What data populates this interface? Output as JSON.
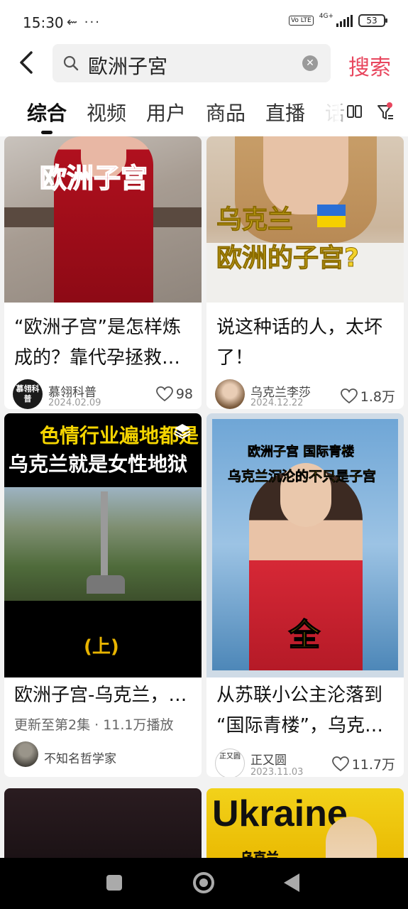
{
  "status_bar": {
    "time": "15:30",
    "left_icons": "⇜ ···",
    "volte": "Vo LTE",
    "network": "4G+",
    "battery": "53"
  },
  "search": {
    "query": "歐洲子宮",
    "button_label": "搜索",
    "clear_icon": "clear-icon",
    "search_icon": "search-icon"
  },
  "tabs": [
    {
      "label": "综合",
      "active": true
    },
    {
      "label": "视频",
      "active": false
    },
    {
      "label": "用户",
      "active": false
    },
    {
      "label": "商品",
      "active": false
    },
    {
      "label": "直播",
      "active": false
    },
    {
      "label": "话",
      "active": false
    }
  ],
  "accent_color": "#e8465e",
  "cards": [
    {
      "overlay": "欧洲子宫",
      "title_line1": "“欧洲子宫”是怎样炼",
      "title_line2": "成的？靠代孕拯救…",
      "author": "慕翎科普",
      "avatar_text": "慕翎科普",
      "date": "2024.02.09",
      "likes": "98"
    },
    {
      "overlay_line1": "乌克兰",
      "overlay_line2": "欧洲的子宫?",
      "title_line1": "说这种话的人，太坏",
      "title_line2": "了！",
      "author": "乌克兰李莎",
      "date": "2024.12.22",
      "likes": "1.8万"
    },
    {
      "overlay_line1": "色情行业遍地都是",
      "overlay_line2": "乌克兰就是女性地狱",
      "overlay_bottom": "(上)",
      "title_line1": "欧洲子宫-乌克兰，…",
      "sub_meta": "更新至第2集 · 11.1万播放",
      "author": "不知名哲学家",
      "collection_icon": "layers-icon"
    },
    {
      "overlay_line1": "欧洲子宫  国际青楼",
      "overlay_line2": "乌克兰沉沦的不只是子宫",
      "overlay_bottom": "全",
      "title_line1": "从苏联小公主沦落到",
      "title_line2": "“国际青楼”，乌克…",
      "author": "正又圆",
      "avatar_text": "正又圆",
      "date": "2023.11.03",
      "likes": "11.7万"
    },
    {
      "overlay": ""
    },
    {
      "overlay_line1": "Ukraine",
      "overlay_line2": "乌克兰"
    }
  ]
}
